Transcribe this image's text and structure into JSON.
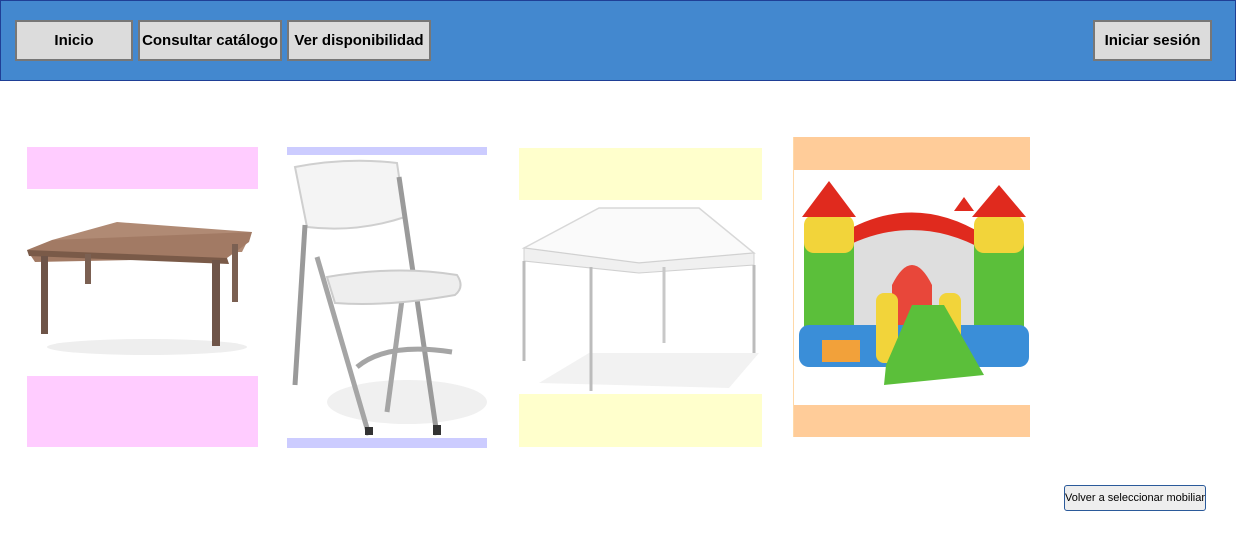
{
  "nav": {
    "inicio": "Inicio",
    "catalogo": "Consultar catálogo",
    "disponibilidad": "Ver disponibilidad",
    "login": "Iniciar sesión"
  },
  "footer": {
    "volver": "Volver a seleccionar mobiliario"
  },
  "items": [
    {
      "icon": "table-image",
      "accent": "#ffccff"
    },
    {
      "icon": "folding-chair-image",
      "accent": "#ccccff"
    },
    {
      "icon": "canopy-tent-image",
      "accent": "#ffffcc"
    },
    {
      "icon": "bounce-castle-image",
      "accent": "#ffcc99"
    }
  ],
  "colors": {
    "topbar": "#4388cf",
    "topbar_border": "#1f3f96",
    "button_bg": "#dcdcdc"
  }
}
